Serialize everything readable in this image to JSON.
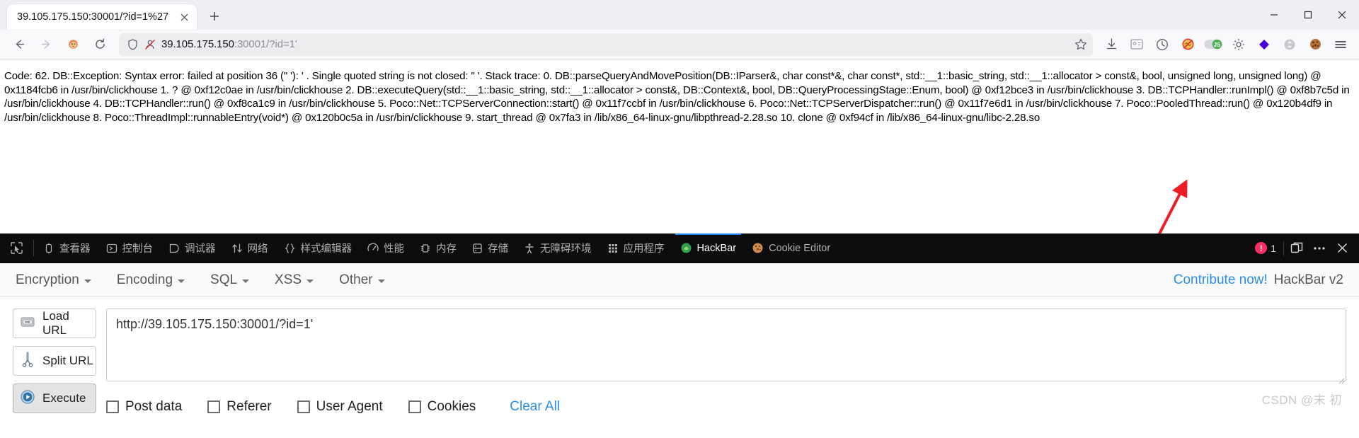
{
  "browser": {
    "tab": {
      "title": "39.105.175.150:30001/?id=1%27",
      "close_icon": "close-icon"
    },
    "new_tab_label": "+",
    "window_controls": {
      "minimize": "–",
      "maximize": "☐",
      "close": "✕"
    },
    "nav": {
      "back": "back-arrow-icon",
      "forward": "forward-arrow-icon",
      "home": "lion-home-icon",
      "reload": "reload-icon"
    },
    "address": {
      "shield_icon": "shield-icon",
      "tracking_icon": "tracking-protection-off-icon",
      "host": "39.105.175.150",
      "path": ":30001/?id=1'"
    },
    "toolbar_icons": [
      "bookmark-star-icon",
      "downloads-icon",
      "account-card-icon",
      "history-clock-icon",
      "adblock-icon",
      "javascript-toggle-icon",
      "settings-gear-icon",
      "wappalyzer-icon",
      "proxy-switch-icon",
      "cookie-editor-icon",
      "app-menu-icon"
    ]
  },
  "page": {
    "error_text": "Code: 62. DB::Exception: Syntax error: failed at position 36 (\" '): ' . Single quoted string is not closed: \" '. Stack trace: 0. DB::parseQueryAndMovePosition(DB::IParser&, char const*&, char const*, std::__1::basic_string, std::__1::allocator > const&, bool, unsigned long, unsigned long) @ 0x1184fcb6 in /usr/bin/clickhouse 1. ? @ 0xf12c0ae in /usr/bin/clickhouse 2. DB::executeQuery(std::__1::basic_string, std::__1::allocator > const&, DB::Context&, bool, DB::QueryProcessingStage::Enum, bool) @ 0xf12bce3 in /usr/bin/clickhouse 3. DB::TCPHandler::runImpl() @ 0xf8b7c5d in /usr/bin/clickhouse 4. DB::TCPHandler::run() @ 0xf8ca1c9 in /usr/bin/clickhouse 5. Poco::Net::TCPServerConnection::start() @ 0x11f7ccbf in /usr/bin/clickhouse 6. Poco::Net::TCPServerDispatcher::run() @ 0x11f7e6d1 in /usr/bin/clickhouse 7. Poco::PooledThread::run() @ 0x120b4df9 in /usr/bin/clickhouse 8. Poco::ThreadImpl::runnableEntry(void*) @ 0x120b0c5a in /usr/bin/clickhouse 9. start_thread @ 0x7fa3 in /lib/x86_64-linux-gnu/libpthread-2.28.so 10. clone @ 0xf94cf in /lib/x86_64-linux-gnu/libc-2.28.so",
    "annotation_arrow": {
      "color": "#ee1c25",
      "name": "red-pointer-arrow"
    }
  },
  "devtools": {
    "picker_icon": "element-picker-icon",
    "tabs": [
      {
        "label": "查看器",
        "icon": "inspector-icon",
        "active": false
      },
      {
        "label": "控制台",
        "icon": "console-icon",
        "active": false
      },
      {
        "label": "调试器",
        "icon": "debugger-icon",
        "active": false
      },
      {
        "label": "网络",
        "icon": "network-icon",
        "active": false
      },
      {
        "label": "样式编辑器",
        "icon": "style-editor-icon",
        "active": false
      },
      {
        "label": "性能",
        "icon": "performance-icon",
        "active": false
      },
      {
        "label": "内存",
        "icon": "memory-icon",
        "active": false
      },
      {
        "label": "存储",
        "icon": "storage-icon",
        "active": false
      },
      {
        "label": "无障碍环境",
        "icon": "accessibility-icon",
        "active": false
      },
      {
        "label": "应用程序",
        "icon": "application-icon",
        "active": false
      },
      {
        "label": "HackBar",
        "icon": "hackbar-icon",
        "active": true
      },
      {
        "label": "Cookie Editor",
        "icon": "cookie-icon",
        "active": false
      }
    ],
    "error_count": "1",
    "error_icon": "error-exclamation-icon",
    "dock_icon": "dock-toggle-icon",
    "more_icon": "more-options-icon",
    "close_icon": "close-devtools-icon",
    "active_tab_underline_color": "#0a84ff"
  },
  "hackbar": {
    "menus": [
      {
        "label": "Encryption"
      },
      {
        "label": "Encoding"
      },
      {
        "label": "SQL"
      },
      {
        "label": "XSS"
      },
      {
        "label": "Other"
      }
    ],
    "contribute_label": "Contribute now!",
    "version_label": "HackBar v2",
    "buttons": [
      {
        "label": "Load URL",
        "icon": "load-url-icon",
        "pressed": false
      },
      {
        "label": "Split URL",
        "icon": "split-url-scissors-icon",
        "pressed": false
      },
      {
        "label": "Execute",
        "icon": "execute-play-icon",
        "pressed": true
      }
    ],
    "url_value": "http://39.105.175.150:30001/?id=1'",
    "url_placeholder": "",
    "options": [
      {
        "label": "Post data",
        "checked": false
      },
      {
        "label": "Referer",
        "checked": false
      },
      {
        "label": "User Agent",
        "checked": false
      },
      {
        "label": "Cookies",
        "checked": false
      }
    ],
    "clear_all_label": "Clear All"
  },
  "watermark": "CSDN @末 初"
}
